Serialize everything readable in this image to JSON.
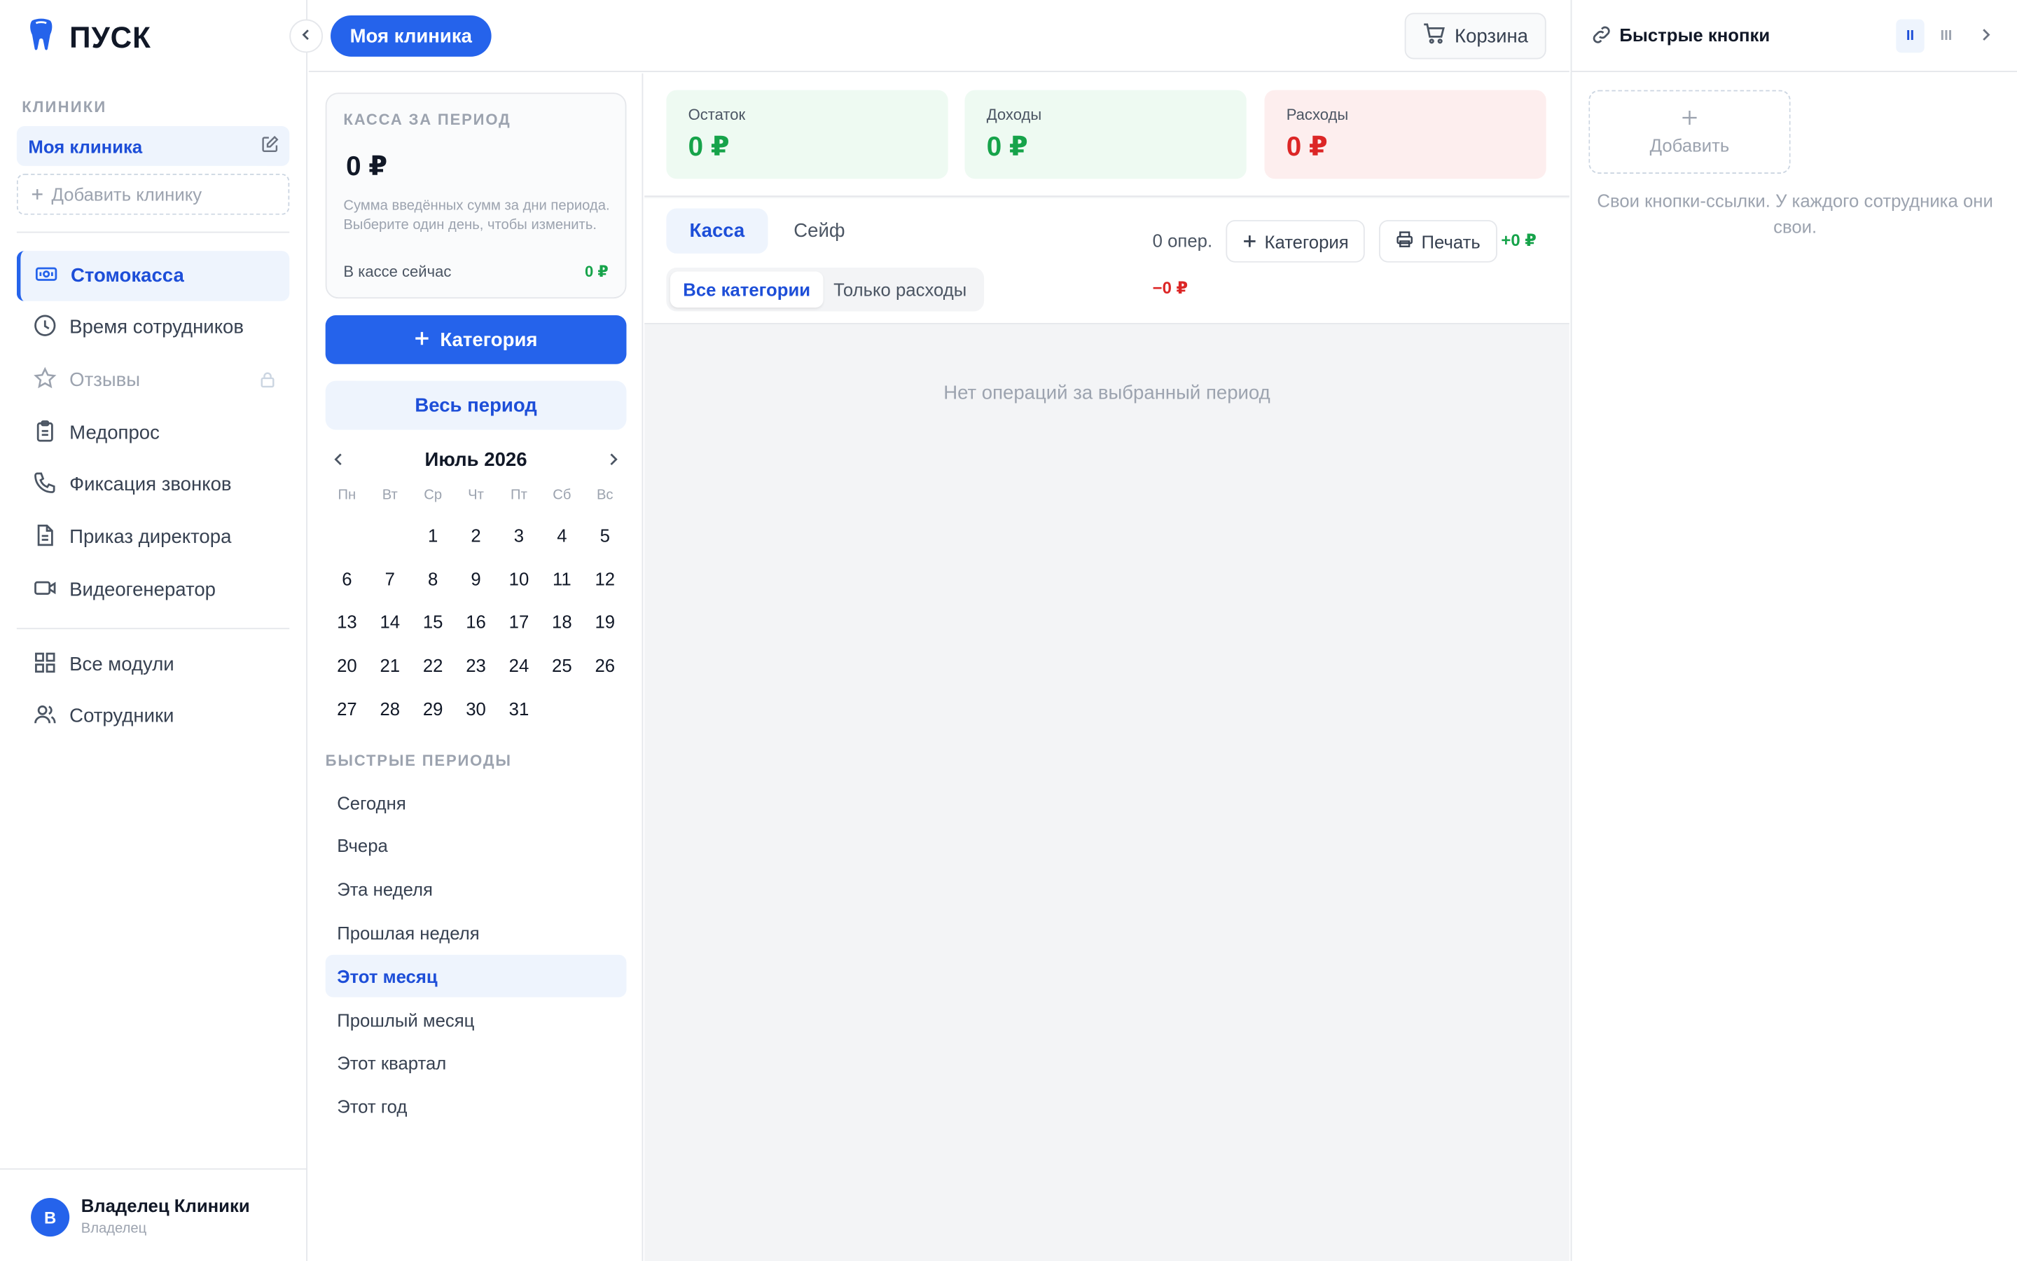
{
  "brand": {
    "name": "ПУСК"
  },
  "sidebar": {
    "clinics_label": "КЛИНИКИ",
    "clinic_name": "Моя клиника",
    "add_clinic": "Добавить клинику",
    "items": [
      {
        "label": "Стомокасса",
        "icon": "cash-icon",
        "active": true
      },
      {
        "label": "Время сотрудников",
        "icon": "clock-icon"
      },
      {
        "label": "Отзывы",
        "icon": "star-icon",
        "disabled": true
      },
      {
        "label": "Медопрос",
        "icon": "clipboard-icon"
      },
      {
        "label": "Фиксация звонков",
        "icon": "phone-icon"
      },
      {
        "label": "Приказ директора",
        "icon": "document-icon"
      },
      {
        "label": "Видеогенератор",
        "icon": "video-icon"
      },
      {
        "label": "Все модули",
        "icon": "grid-icon"
      },
      {
        "label": "Сотрудники",
        "icon": "users-icon"
      }
    ],
    "user": {
      "initial": "В",
      "name": "Владелец Клиники",
      "role": "Владелец"
    }
  },
  "topbar": {
    "clinic_pill": "Моя клиника",
    "cart_label": "Корзина"
  },
  "kassa": {
    "title": "КАССА ЗА ПЕРИОД",
    "sum": "0 ₽",
    "description": "Сумма введённых сумм за дни периода. Выберите один день, чтобы изменить.",
    "now_label": "В кассе сейчас",
    "now_value": "0 ₽",
    "category_button": "Категория",
    "period_button": "Весь период"
  },
  "calendar": {
    "month": "Июль 2026",
    "weekdays": [
      "Пн",
      "Вт",
      "Ср",
      "Чт",
      "Пт",
      "Сб",
      "Вс"
    ],
    "leading_blanks": 2,
    "days": 31
  },
  "quick_periods": {
    "label": "БЫСТРЫЕ ПЕРИОДЫ",
    "items": [
      "Сегодня",
      "Вчера",
      "Эта неделя",
      "Прошлая неделя",
      "Этот месяц",
      "Прошлый месяц",
      "Этот квартал",
      "Этот год"
    ],
    "active": "Этот месяц"
  },
  "stats": {
    "balance": {
      "label": "Остаток",
      "value": "0 ₽"
    },
    "income": {
      "label": "Доходы",
      "value": "0 ₽"
    },
    "expenses": {
      "label": "Расходы",
      "value": "0 ₽"
    }
  },
  "tabs": {
    "cash": "Касса",
    "safe": "Сейф"
  },
  "filters": {
    "all": "Все категории",
    "expenses_only": "Только расходы"
  },
  "toolbar": {
    "ops_count": "0 опер.",
    "category_button": "Категория",
    "print_button": "Печать",
    "plus_total": "+0 ₽",
    "minus_total": "−0 ₽"
  },
  "empty_state": "Нет операций за выбранный период",
  "right_panel": {
    "title": "Быстрые кнопки",
    "col_two": "II",
    "col_three": "III",
    "add_label": "Добавить",
    "hint": "Свои кнопки-ссылки. У каждого сотрудника они свои."
  },
  "colors": {
    "accent": "#2563eb",
    "accent_soft": "#eef4fd",
    "income": "#16a34a",
    "expense": "#dc2626",
    "balance_bg": "#eefaf2",
    "income_bg": "#eefaf2",
    "expense_bg": "#fdeeee"
  }
}
